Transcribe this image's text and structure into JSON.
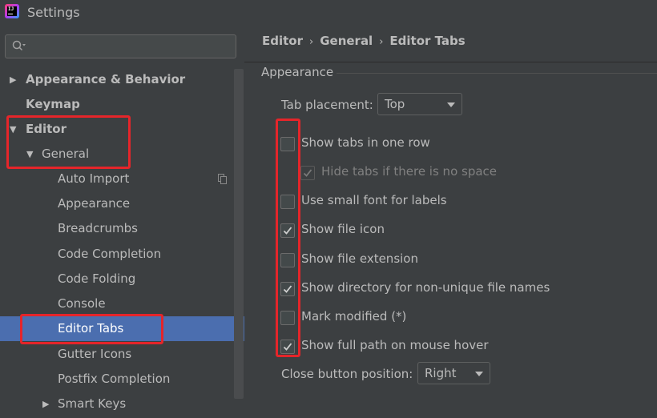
{
  "window": {
    "title": "Settings",
    "app_icon": "intellij-idea-icon"
  },
  "search": {
    "value": "",
    "icon": "search-icon"
  },
  "tree": [
    {
      "label": "Appearance & Behavior",
      "level": 0,
      "expandable": true,
      "expanded": false,
      "bold": true
    },
    {
      "label": "Keymap",
      "level": 0,
      "expandable": false,
      "bold": true
    },
    {
      "label": "Editor",
      "level": 0,
      "expandable": true,
      "expanded": true,
      "bold": true
    },
    {
      "label": "General",
      "level": 1,
      "expandable": true,
      "expanded": true
    },
    {
      "label": "Auto Import",
      "level": 2
    },
    {
      "label": "Appearance",
      "level": 2
    },
    {
      "label": "Breadcrumbs",
      "level": 2
    },
    {
      "label": "Code Completion",
      "level": 2
    },
    {
      "label": "Code Folding",
      "level": 2
    },
    {
      "label": "Console",
      "level": 2
    },
    {
      "label": "Editor Tabs",
      "level": 2,
      "selected": true
    },
    {
      "label": "Gutter Icons",
      "level": 2
    },
    {
      "label": "Postfix Completion",
      "level": 2
    },
    {
      "label": "Smart Keys",
      "level": 2,
      "expandable": true,
      "expanded": false
    }
  ],
  "breadcrumb": [
    "Editor",
    "General",
    "Editor Tabs"
  ],
  "appearance_group": {
    "title": "Appearance"
  },
  "tab_placement": {
    "label": "Tab placement:",
    "value": "Top"
  },
  "options": [
    {
      "label": "Show tabs in one row",
      "checked": false,
      "enabled": true,
      "indent": false
    },
    {
      "label": "Hide tabs if there is no space",
      "checked": true,
      "enabled": false,
      "indent": true
    },
    {
      "label": "Use small font for labels",
      "checked": false,
      "enabled": true,
      "indent": false
    },
    {
      "label": "Show file icon",
      "checked": true,
      "enabled": true,
      "indent": false
    },
    {
      "label": "Show file extension",
      "checked": false,
      "enabled": true,
      "indent": false
    },
    {
      "label": "Show directory for non-unique file names",
      "checked": true,
      "enabled": true,
      "indent": false
    },
    {
      "label": "Mark modified (*)",
      "checked": false,
      "enabled": true,
      "indent": false
    },
    {
      "label": "Show full path on mouse hover",
      "checked": true,
      "enabled": true,
      "indent": false
    }
  ],
  "close_button": {
    "label": "Close button position:",
    "value": "Right"
  },
  "colors": {
    "selection": "#4b6eaf",
    "annotation": "#e5252a",
    "background": "#3c3f41"
  }
}
